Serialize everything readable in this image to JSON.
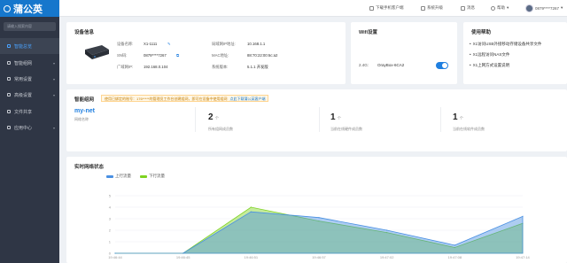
{
  "app": {
    "name": "蒲公英"
  },
  "sidebar": {
    "search_placeholder": "请输入搜索内容",
    "items": [
      {
        "label": "智能总览",
        "active": true
      },
      {
        "label": "智能组网",
        "active": false
      },
      {
        "label": "常用设置",
        "active": false
      },
      {
        "label": "高级设置",
        "active": false
      },
      {
        "label": "文件共享",
        "active": false
      },
      {
        "label": "应用中心",
        "active": false
      }
    ]
  },
  "topbar": {
    "download_app": "下载手机客户端",
    "system_upgrade": "系统升级",
    "messages": "消息",
    "help": "帮助",
    "account": "0879****7267"
  },
  "device_info": {
    "title": "设备信息",
    "model_label": "设备名称:",
    "model_value": "X1-1111",
    "sn_label": "SN码:",
    "sn_value": "0879****7267",
    "lan_label": "广域网IP:",
    "lan_value": "192.168.0.104",
    "lan_ip_label": "局域网IP地址:",
    "lan_ip_value": "10.168.1.1",
    "mac_label": "MAC地址:",
    "mac_value": "88:70:22:00:6c:a2",
    "version_label": "系统版本:",
    "version_value": "5.1.1 开发版"
  },
  "wifi": {
    "title": "Wifi设置",
    "band": "2.4G:",
    "ssid": "OrayBox-6CA2",
    "enabled": true
  },
  "help_card": {
    "title": "使用帮助",
    "items": [
      "X1访问USB外接移动存储设备共享文件",
      "X1远程访问NAS文件",
      "X1上网方式设置说明"
    ]
  },
  "networking": {
    "title": "智能组网",
    "notice": "使用已绑定的账号：176*****的管理员工作台创建组网，即可在设备中使用组网",
    "notice_link": "点此下载蒲公英客户端",
    "network_name": "my-net",
    "network_name_label": "网络名称",
    "stats": [
      {
        "value": "2",
        "unit": "个",
        "label": "所有组网成员数"
      },
      {
        "value": "1",
        "unit": "个",
        "label": "当前在线硬件成员数"
      },
      {
        "value": "1",
        "unit": "个",
        "label": "当前在线软件成员数"
      }
    ]
  },
  "realtime": {
    "title": "实时网络状态",
    "legend_up": "上行流量",
    "legend_down": "下行流量",
    "color_up": "#4a90e2",
    "color_down": "#7ed321"
  },
  "chart_data": {
    "type": "area",
    "x": [
      "19:46:44",
      "19:46:45",
      "19:46:51",
      "19:46:57",
      "19:47:02",
      "19:47:08",
      "19:47:14"
    ],
    "y_ticks": [
      0,
      1,
      2,
      3,
      4,
      5
    ],
    "ylim": [
      0,
      5
    ],
    "series": [
      {
        "name": "上行流量",
        "values": [
          0,
          0,
          3.6,
          3.1,
          2.0,
          0.7,
          3.2
        ]
      },
      {
        "name": "下行流量",
        "values": [
          0,
          0,
          4.0,
          2.8,
          1.8,
          0.5,
          2.6
        ]
      }
    ],
    "legend": "top-left"
  }
}
